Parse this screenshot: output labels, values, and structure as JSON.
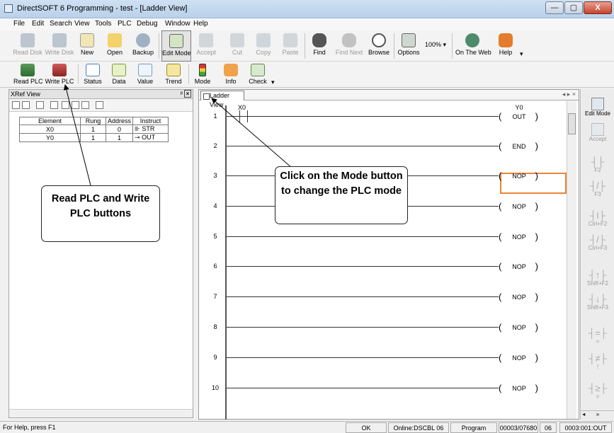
{
  "window": {
    "title": "DirectSOFT 6 Programming - test - [Ladder View]",
    "min": "—",
    "max": "▢",
    "close": "X"
  },
  "menu": [
    "File",
    "Edit",
    "Search",
    "View",
    "Tools",
    "PLC",
    "Debug",
    "Window",
    "Help"
  ],
  "toolbar1": {
    "read_disk": "Read Disk",
    "write_disk": "Write Disk",
    "new": "New",
    "open": "Open",
    "backup": "Backup",
    "edit_mode": "Edit Mode",
    "accept": "Accept",
    "cut": "Cut",
    "copy": "Copy",
    "paste": "Paste",
    "find": "Find",
    "find_next": "Find Next",
    "browse": "Browse",
    "options": "Options",
    "zoom": "100%",
    "on_the_web": "On The Web",
    "help": "Help"
  },
  "toolbar2": {
    "read_plc": "Read PLC",
    "write_plc": "Write PLC",
    "status": "Status",
    "data": "Data",
    "value": "Value",
    "trend": "Trend",
    "mode": "Mode",
    "info": "Info",
    "check": "Check"
  },
  "xref": {
    "title": "XRef View",
    "columns": [
      "Element",
      "Rung",
      "Address",
      "Instruct"
    ],
    "rows": [
      {
        "element": "X0",
        "rung": "1",
        "address": "0",
        "instruct": "STR"
      },
      {
        "element": "Y0",
        "rung": "1",
        "address": "1",
        "instruct": "OUT"
      }
    ]
  },
  "ladder": {
    "tab": "Ladder View",
    "contact_label": "X0",
    "rungs": [
      {
        "num": "1",
        "instr": "OUT",
        "addr": "Y0"
      },
      {
        "num": "2",
        "instr": "END"
      },
      {
        "num": "3",
        "instr": "NOP"
      },
      {
        "num": "4",
        "instr": "NOP"
      },
      {
        "num": "5",
        "instr": "NOP"
      },
      {
        "num": "6",
        "instr": "NOP"
      },
      {
        "num": "7",
        "instr": "NOP"
      },
      {
        "num": "8",
        "instr": "NOP"
      },
      {
        "num": "9",
        "instr": "NOP"
      },
      {
        "num": "10",
        "instr": "NOP"
      }
    ]
  },
  "palette": {
    "edit_mode": "Edit Mode",
    "accept": "Accept",
    "keys": [
      "F2",
      "F3",
      "Ctrl+F2",
      "Ctrl+F3",
      "Shift+F2",
      "Shift+F3",
      "=",
      "!",
      ">"
    ]
  },
  "status": {
    "help": "For Help, press F1",
    "ok": "OK",
    "link": "Online:DSCBL 06",
    "mode": "Program",
    "memory": "00003/07680",
    "cpu": "06",
    "location": "0003:001:OUT"
  },
  "callouts": {
    "mode": "Click on the Mode button to change the PLC mode",
    "plc": "Read PLC and Write PLC buttons"
  }
}
